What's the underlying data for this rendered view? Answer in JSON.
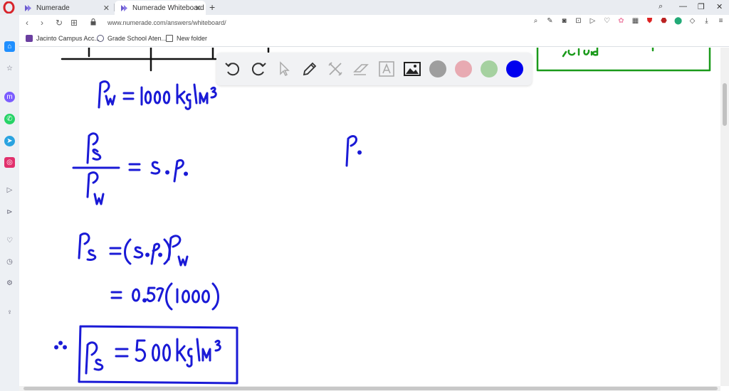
{
  "tabs": [
    {
      "title": "Numerade",
      "active": false
    },
    {
      "title": "Numerade Whiteboard",
      "active": true
    }
  ],
  "address": {
    "url": "www.numerade.com/answers/whiteboard/"
  },
  "bookmarks": [
    {
      "label": "Jacinto Campus Acc..."
    },
    {
      "label": "Grade School Aten..."
    },
    {
      "label": "New folder"
    }
  ],
  "toolbar": {
    "tools": [
      "undo-icon",
      "redo-icon",
      "pointer-icon",
      "pencil-icon",
      "tools-icon",
      "eraser-icon",
      "text-icon",
      "image-icon"
    ],
    "colors": [
      {
        "name": "gray",
        "hex": "#9e9e9e"
      },
      {
        "name": "pink",
        "hex": "#e8aab2"
      },
      {
        "name": "light-green",
        "hex": "#a5d1a0"
      },
      {
        "name": "blue",
        "hex": "#0000ee",
        "selected": true
      }
    ]
  },
  "colors": {
    "ink_blue": "#1a1ad6",
    "ink_green": "#1a9a1a",
    "tab_bar": "#e9ecf1",
    "opera_red": "#d8232a"
  }
}
